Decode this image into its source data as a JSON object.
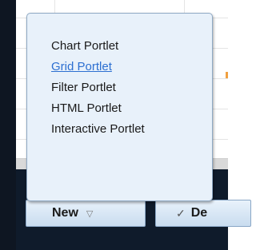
{
  "menu": {
    "items": [
      {
        "label": "Chart Portlet",
        "state": "normal"
      },
      {
        "label": "Grid Portlet",
        "state": "hover"
      },
      {
        "label": "Filter Portlet",
        "state": "normal"
      },
      {
        "label": "HTML Portlet",
        "state": "normal"
      },
      {
        "label": "Interactive Portlet",
        "state": "normal"
      }
    ]
  },
  "toolbar": {
    "new_label": "New",
    "new_caret_icon": "chevron-down-icon",
    "second_label": "De",
    "second_icon": "check-icon"
  },
  "background": {
    "ghost_text": "' ' '"
  },
  "colors": {
    "menu_bg": "#e8f1fa",
    "menu_border": "#8fa9c4",
    "hover_link": "#2c6fd1",
    "toolbar_bg": "#0f1b2b",
    "button_bg_top": "#e9f2fb",
    "button_bg_bottom": "#c9dcef"
  }
}
